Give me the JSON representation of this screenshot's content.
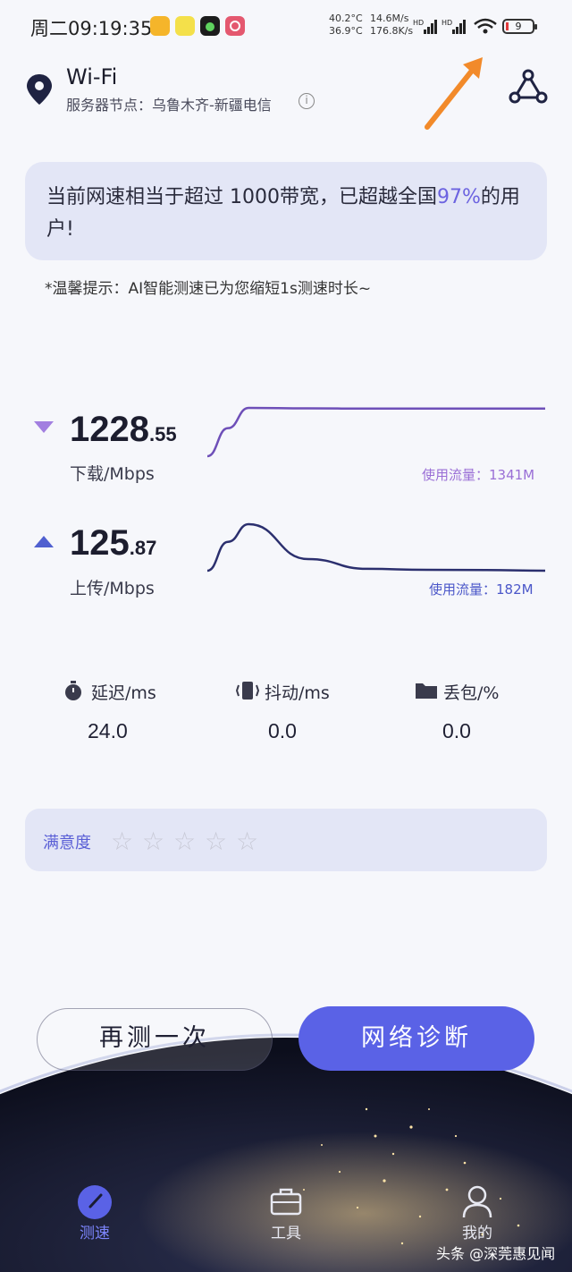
{
  "status_bar": {
    "time": "周二09:19:35",
    "temp_1": "40.2°C",
    "temp_2": "36.9°C",
    "rate_up": "14.6M/s",
    "rate_down": "176.8K/s",
    "signal_1_label": "HD",
    "signal_2_label": "HD",
    "battery": "9",
    "app_icons": [
      {
        "name": "notes-app-icon",
        "color": "#f5b52a"
      },
      {
        "name": "news-app-icon",
        "color": "#f4e04a"
      },
      {
        "name": "music-app-icon",
        "color": "#1c1c1c"
      },
      {
        "name": "camera-app-icon",
        "color": "#e4586f"
      }
    ]
  },
  "header": {
    "network_type": "Wi-Fi",
    "server_node": "服务器节点：乌鲁木齐-新疆电信",
    "info_glyph": "i"
  },
  "banner": {
    "text_before": "当前网速相当于超过 1000带宽，已超越全国",
    "highlight": "97%",
    "text_after": "的用户!",
    "highlight_color": "#6c63e0"
  },
  "tip": "*温馨提示：AI智能测速已为您缩短1s测速时长~",
  "download": {
    "value_int": "1228",
    "value_dec": ".55",
    "unit": "下载/Mbps",
    "traffic": "使用流量：1341M",
    "color": "#9a6fd6",
    "curve": [
      0,
      0.58,
      1,
      0.99,
      0.985,
      0.985,
      0.985,
      0.985
    ]
  },
  "upload": {
    "value_int": "125",
    "value_dec": ".87",
    "unit": "上传/Mbps",
    "traffic": "使用流量：182M",
    "color": "#4b57c9",
    "curve": [
      0,
      0.62,
      1,
      0.25,
      0.04,
      0.02,
      0.015,
      0.0
    ]
  },
  "metrics": [
    {
      "label": "延迟/ms",
      "value": "24.0",
      "icon": "stopwatch-icon"
    },
    {
      "label": "抖动/ms",
      "value": "0.0",
      "icon": "vibration-icon"
    },
    {
      "label": "丢包/%",
      "value": "0.0",
      "icon": "folder-icon"
    }
  ],
  "satisfaction": {
    "label": "满意度",
    "rating": 0,
    "max": 5
  },
  "buttons": {
    "retest": "再测一次",
    "diagnose": "网络诊断"
  },
  "nav": [
    {
      "label": "测速",
      "icon": "speedometer-icon",
      "active": true
    },
    {
      "label": "工具",
      "icon": "toolbox-icon",
      "active": false
    },
    {
      "label": "我的",
      "icon": "profile-icon",
      "active": false
    }
  ],
  "watermark": "头条 @深莞惠见闻",
  "colors": {
    "accent": "#5a62e6",
    "annotation_arrow": "#f28a2a"
  }
}
